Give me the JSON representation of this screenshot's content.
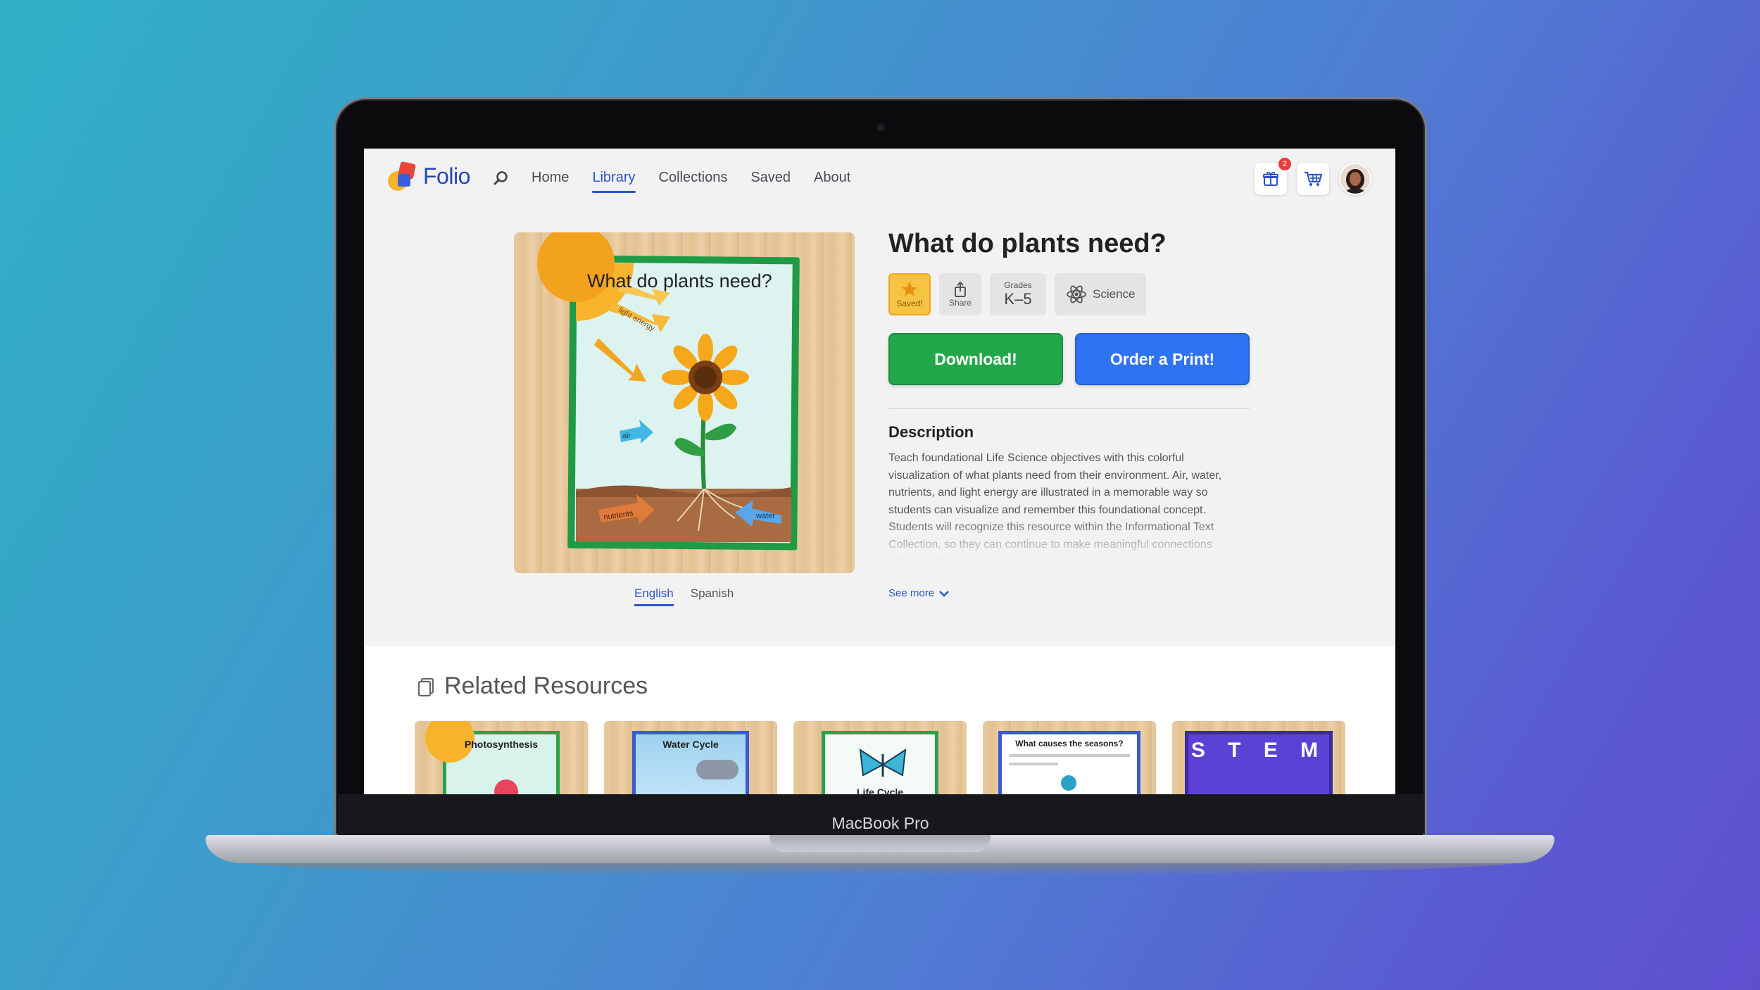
{
  "device": {
    "label": "MacBook Pro"
  },
  "nav": {
    "logo_text": "Folio",
    "links": [
      "Home",
      "Library",
      "Collections",
      "Saved",
      "About"
    ],
    "active_link": "Library",
    "gift_badge_count": "2"
  },
  "product": {
    "title": "What do plants need?",
    "poster": {
      "title": "What do plants need?",
      "labels": {
        "light": "light energy",
        "air": "air",
        "nutrients": "nutrients",
        "water": "water"
      }
    },
    "chips": {
      "saved": "Saved!",
      "share": "Share",
      "grades_label": "Grades",
      "grades_value": "K–5",
      "subject": "Science"
    },
    "buttons": {
      "download": "Download!",
      "order": "Order a Print!"
    },
    "languages": [
      "English",
      "Spanish"
    ],
    "active_language": "English",
    "description_heading": "Description",
    "description": "Teach foundational Life Science objectives with this colorful visualization of what plants need from their environment. Air, water, nutrients, and light energy are illustrated in a memorable way so students can visualize and remember this foundational concept. Students will recognize this resource within the Informational Text Collection, so they can continue to make meaningful connections among subjects.",
    "see_more": "See more"
  },
  "related": {
    "heading": "Related Resources",
    "cards": [
      {
        "title": "Photosynthesis"
      },
      {
        "title": "Water Cycle"
      },
      {
        "title": "Life Cycle"
      },
      {
        "title": "What causes the seasons?"
      },
      {
        "title": "S T E M"
      }
    ]
  },
  "colors": {
    "primary": "#2b54c9",
    "download": "#22a84a",
    "order": "#2f73f5",
    "saved": "#f6c343"
  }
}
